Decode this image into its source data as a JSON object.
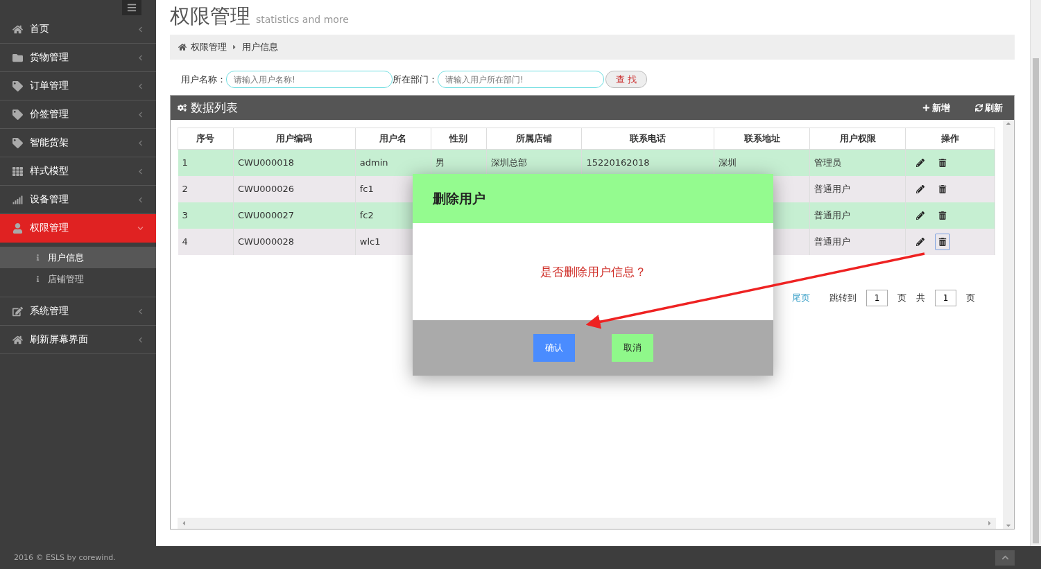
{
  "page": {
    "title": "权限管理",
    "subtitle": "statistics and more"
  },
  "sidebar": {
    "items": [
      {
        "label": "首页",
        "selected": false,
        "expanded": false
      },
      {
        "label": "货物管理",
        "selected": false,
        "expanded": false
      },
      {
        "label": "订单管理",
        "selected": false,
        "expanded": false
      },
      {
        "label": "价签管理",
        "selected": false,
        "expanded": false
      },
      {
        "label": "智能货架",
        "selected": false,
        "expanded": false
      },
      {
        "label": "样式模型",
        "selected": false,
        "expanded": false
      },
      {
        "label": "设备管理",
        "selected": false,
        "expanded": false
      },
      {
        "label": "权限管理",
        "selected": true,
        "expanded": true,
        "children": [
          {
            "label": "用户信息",
            "selected": true
          },
          {
            "label": "店铺管理",
            "selected": false
          }
        ]
      },
      {
        "label": "系统管理",
        "selected": false,
        "expanded": false
      },
      {
        "label": "刷新屏幕界面",
        "selected": false,
        "expanded": false
      }
    ]
  },
  "breadcrumb": [
    "权限管理",
    "用户信息"
  ],
  "search": {
    "fields": [
      {
        "label": "用户名称：",
        "placeholder": "请输入用户名称!"
      },
      {
        "label": "所在部门：",
        "placeholder": "请输入用户所在部门!"
      }
    ],
    "button": "查 找"
  },
  "panel": {
    "title": "数据列表",
    "actions": [
      "新增",
      "刷新"
    ]
  },
  "table": {
    "columns": [
      "序号",
      "用户编码",
      "用户名",
      "性别",
      "所属店铺",
      "联系电话",
      "联系地址",
      "用户权限",
      "操作"
    ],
    "rows": [
      {
        "cells": [
          "1",
          "CWU000018",
          "admin",
          "男",
          "深圳总部",
          "15220162018",
          "深圳",
          "管理员"
        ],
        "focused": false
      },
      {
        "cells": [
          "2",
          "CWU000026",
          "fc1",
          "",
          "",
          "",
          "",
          "普通用户"
        ],
        "focused": false
      },
      {
        "cells": [
          "3",
          "CWU000027",
          "fc2",
          "",
          "",
          "",
          "",
          "普通用户"
        ],
        "focused": false
      },
      {
        "cells": [
          "4",
          "CWU000028",
          "wlc1",
          "",
          "",
          "",
          "",
          "普通用户"
        ],
        "focused": true
      }
    ]
  },
  "pagination": {
    "last": "尾页",
    "jump_label": "跳转到",
    "page": "1",
    "page_unit": "页",
    "total_label": "共",
    "total": "1",
    "total_unit": "页"
  },
  "dialog": {
    "title": "删除用户",
    "message": "是否删除用户信息？",
    "buttons": [
      {
        "label": "确认",
        "kind": "primary"
      },
      {
        "label": "取消",
        "kind": "secondary"
      }
    ]
  },
  "footer": {
    "text": "2016 © ESLS by corewind."
  }
}
